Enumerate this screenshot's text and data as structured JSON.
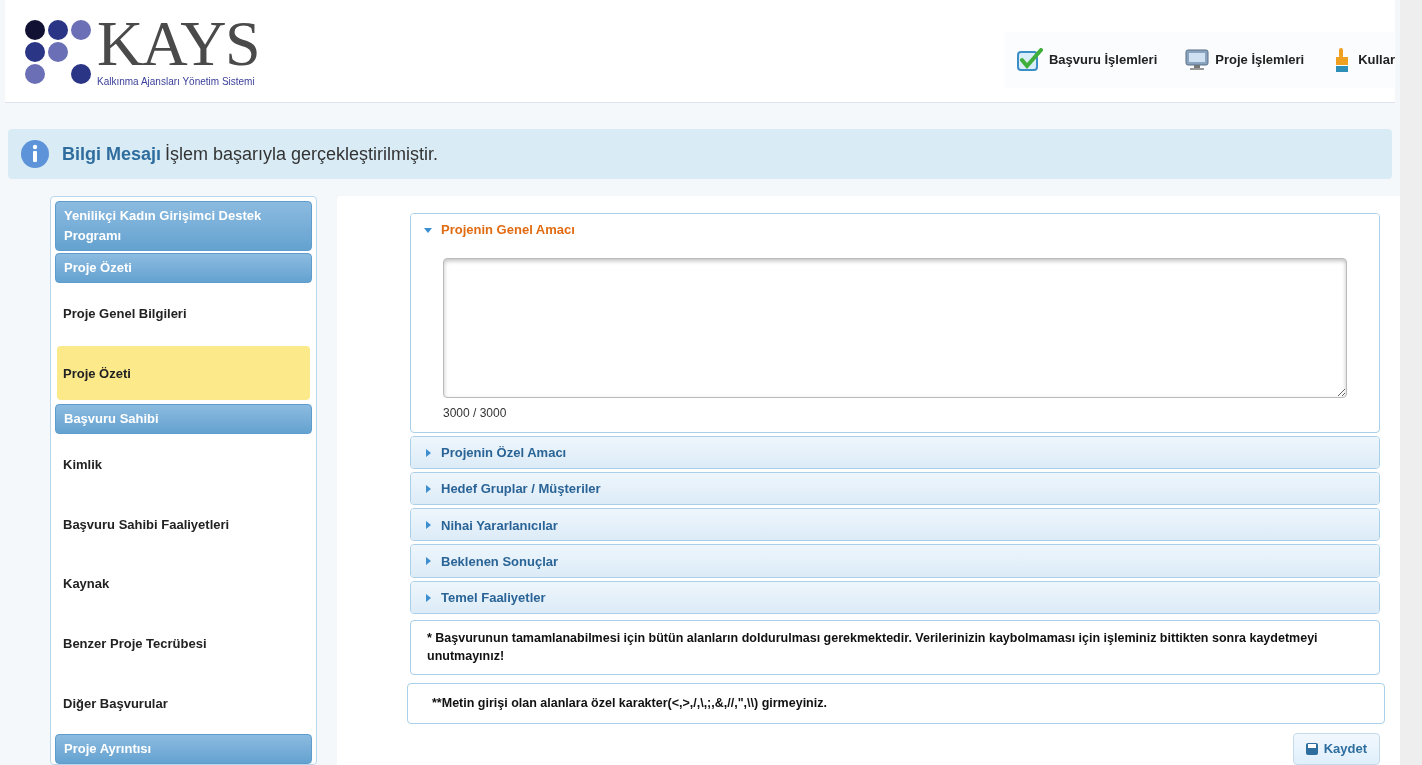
{
  "logo": {
    "name": "KAYS",
    "subtitle": "Kalkınma Ajansları Yönetim Sistemi"
  },
  "top_menu": [
    {
      "label": "Başvuru İşlemleri",
      "kind": "check"
    },
    {
      "label": "Proje İşlemleri",
      "kind": "monitor"
    },
    {
      "label": "Kullar",
      "kind": "hand"
    }
  ],
  "info_message": {
    "title": "Bilgi Mesajı",
    "text": "İşlem başarıyla gerçekleştirilmiştir."
  },
  "sidebar": {
    "items": [
      {
        "kind": "header",
        "label": "Yenilikçi Kadın Girişimci Destek Programı"
      },
      {
        "kind": "header",
        "label": "Proje Özeti"
      },
      {
        "kind": "link",
        "label": "Proje Genel Bilgileri",
        "selected": false
      },
      {
        "kind": "link",
        "label": "Proje Özeti",
        "selected": true
      },
      {
        "kind": "header",
        "label": "Başvuru Sahibi"
      },
      {
        "kind": "link",
        "label": "Kimlik",
        "selected": false
      },
      {
        "kind": "link",
        "label": "Başvuru Sahibi Faaliyetleri",
        "selected": false
      },
      {
        "kind": "link",
        "label": "Kaynak",
        "selected": false
      },
      {
        "kind": "link",
        "label": "Benzer Proje Tecrübesi",
        "selected": false
      },
      {
        "kind": "link",
        "label": "Diğer Başvurular",
        "selected": false
      },
      {
        "kind": "header",
        "label": "Proje Ayrıntısı"
      }
    ]
  },
  "sections": [
    {
      "title": "Projenin Genel Amacı",
      "expanded": true,
      "counter": "3000 / 3000"
    },
    {
      "title": "Projenin Özel Amacı",
      "expanded": false
    },
    {
      "title": "Hedef Gruplar / Müşteriler",
      "expanded": false
    },
    {
      "title": "Nihai Yararlanıcılar",
      "expanded": false
    },
    {
      "title": "Beklenen Sonuçlar",
      "expanded": false
    },
    {
      "title": "Temel Faaliyetler",
      "expanded": false
    }
  ],
  "notes": [
    "* Başvurunun tamamlanabilmesi için bütün alanların doldurulması gerekmektedir. Verilerinizin kaybolmaması için işleminiz bittikten sonra kaydetmeyi unutmayınız!",
    "**Metin girişi olan alanlara özel karakter(<,>,/,\\,;,&,//,\",\\\\) girmeyiniz."
  ],
  "save_button": "Kaydet"
}
